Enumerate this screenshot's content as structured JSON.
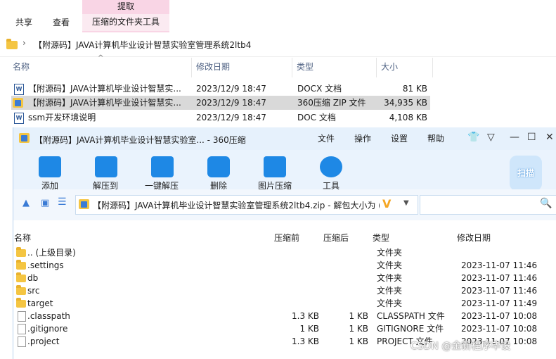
{
  "explorer": {
    "ribbon": {
      "context_tab": "提取",
      "tabs": [
        "共享",
        "查看"
      ],
      "active_tab": "压缩的文件夹工具"
    },
    "address": "【附源码】JAVA计算机毕业设计智慧实验室管理系统2ltb4",
    "columns": {
      "name": "名称",
      "date": "修改日期",
      "type": "类型",
      "size": "大小"
    },
    "files": [
      {
        "name": "【附源码】JAVA计算机毕业设计智慧实...",
        "date": "2023/12/9 18:47",
        "type": "DOCX 文档",
        "size": "81 KB",
        "icon": "word-doc-icon"
      },
      {
        "name": "【附源码】JAVA计算机毕业设计智慧实...",
        "date": "2023/12/9 18:47",
        "type": "360压缩 ZIP 文件",
        "size": "34,935 KB",
        "icon": "zip-archive-icon"
      },
      {
        "name": "ssm开发环境说明",
        "date": "2023/12/9 18:47",
        "type": "DOC 文档",
        "size": "4,108 KB",
        "icon": "word-doc-icon"
      }
    ]
  },
  "zip": {
    "title": "【附源码】JAVA计算机毕业设计智慧实验室... - 360压缩",
    "menu": [
      "文件",
      "操作",
      "设置",
      "帮助"
    ],
    "toolbar": [
      "添加",
      "解压到",
      "一键解压",
      "删除",
      "图片压缩",
      "工具"
    ],
    "scan_label": "扫描",
    "path": "【附源码】JAVA计算机毕业设计智慧实验室管理系统2ltb4.zip - 解包大小为 (",
    "columns": {
      "name": "名称",
      "before": "压缩前",
      "after": "压缩后",
      "type": "类型",
      "date": "修改日期"
    },
    "rows": [
      {
        "name": ".. (上级目录)",
        "before": "",
        "after": "",
        "type": "文件夹",
        "date": "",
        "kind": "folder"
      },
      {
        "name": ".settings",
        "before": "",
        "after": "",
        "type": "文件夹",
        "date": "2023-11-07 11:46",
        "kind": "folder"
      },
      {
        "name": "db",
        "before": "",
        "after": "",
        "type": "文件夹",
        "date": "2023-11-07 11:46",
        "kind": "folder"
      },
      {
        "name": "src",
        "before": "",
        "after": "",
        "type": "文件夹",
        "date": "2023-11-07 11:46",
        "kind": "folder"
      },
      {
        "name": "target",
        "before": "",
        "after": "",
        "type": "文件夹",
        "date": "2023-11-07 11:49",
        "kind": "folder"
      },
      {
        "name": ".classpath",
        "before": "1.3 KB",
        "after": "1 KB",
        "type": "CLASSPATH 文件",
        "date": "2023-11-07 10:08",
        "kind": "file"
      },
      {
        "name": ".gitignore",
        "before": "1 KB",
        "after": "1 KB",
        "type": "GITIGNORE 文件",
        "date": "2023-11-07 10:08",
        "kind": "file"
      },
      {
        "name": ".project",
        "before": "1.3 KB",
        "after": "1 KB",
        "type": "PROJECT 文件",
        "date": "2023-11-07 10:08",
        "kind": "file"
      }
    ]
  },
  "watermark": "CSDN @金新程序毕设",
  "colors": {
    "accent": "#1e88e5",
    "context_tab": "#f9d5e5",
    "selection": "#d9d9d9"
  }
}
